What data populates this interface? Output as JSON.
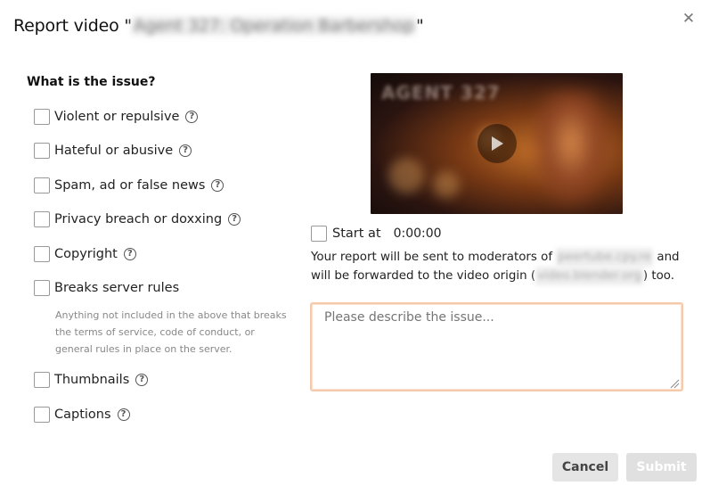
{
  "dialog": {
    "title_prefix": "Report video \"",
    "video_name": "Agent 327: Operation Barbershop",
    "title_suffix": "\"",
    "close_icon": "close-icon"
  },
  "issue_question": "What is the issue?",
  "options": [
    {
      "label": "Violent or repulsive",
      "checked": false,
      "has_help": true
    },
    {
      "label": "Hateful or abusive",
      "checked": false,
      "has_help": true
    },
    {
      "label": "Spam, ad or false news",
      "checked": false,
      "has_help": true
    },
    {
      "label": "Privacy breach or doxxing",
      "checked": false,
      "has_help": true
    },
    {
      "label": "Copyright",
      "checked": false,
      "has_help": true
    },
    {
      "label": "Breaks server rules",
      "checked": false,
      "has_help": false
    },
    {
      "label": "Thumbnails",
      "checked": false,
      "has_help": true
    },
    {
      "label": "Captions",
      "checked": false,
      "has_help": true
    }
  ],
  "server_rules_hint": "Anything not included in the above that breaks the terms of service, code of conduct, or general rules in place on the server.",
  "video_preview": {
    "overlay_title": "AGENT 327",
    "play_icon": "play-icon"
  },
  "start_at": {
    "label": "Start at",
    "value": "0:00:00",
    "checked": false
  },
  "notice": {
    "part1": "Your report will be sent to moderators of ",
    "instance": "peertube.cpy.re",
    "part2": " and will be forwarded to the video origin (",
    "origin": "video.blender.org",
    "part3": ") too."
  },
  "description": {
    "placeholder": "Please describe the issue...",
    "value": ""
  },
  "buttons": {
    "cancel": "Cancel",
    "submit": "Submit"
  },
  "colors": {
    "textarea_border": "#f5c9aa",
    "cancel_bg": "#e5e5e5",
    "submit_bg": "#e0e0e0"
  }
}
